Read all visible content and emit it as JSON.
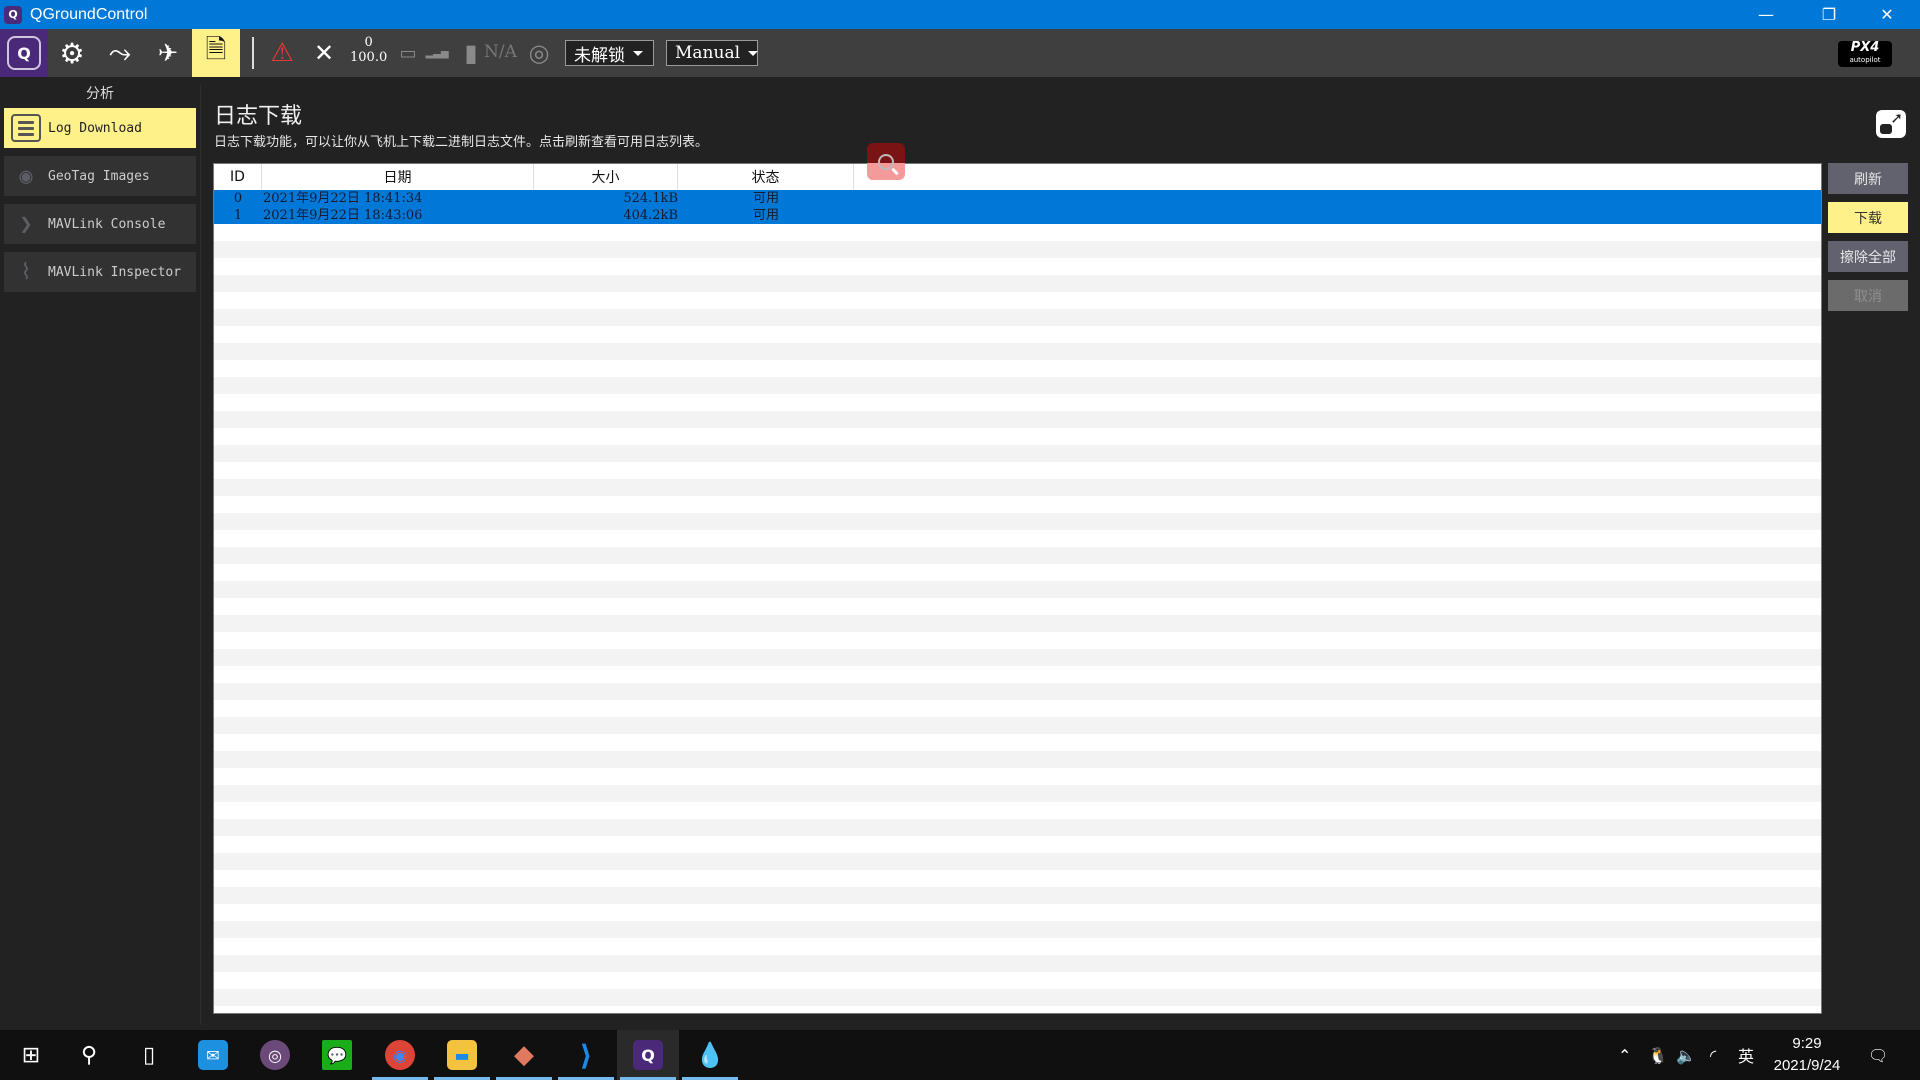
{
  "window": {
    "title": "QGroundControl",
    "controls": {
      "minimize": "—",
      "restore": "❐",
      "close": "✕"
    }
  },
  "toolbar": {
    "items": [
      {
        "name": "qgc-home",
        "icon": "qgc-logo-icon",
        "label": "Q"
      },
      {
        "name": "vehicle-setup",
        "icon": "gears-icon",
        "label": "⚙"
      },
      {
        "name": "plan-flight",
        "icon": "route-icon",
        "label": "⤳"
      },
      {
        "name": "fly",
        "icon": "paper-plane-icon",
        "label": "✈"
      },
      {
        "name": "analyze",
        "icon": "document-search-icon",
        "label": "🗎",
        "active": true
      }
    ],
    "status": {
      "warning_icon": "⚠",
      "gps_icon": "✕",
      "gps_satellites": "0",
      "gps_hdop": "100.0",
      "rc_icon": "▭",
      "signal_icon": "▂▃▅",
      "battery_icon": "▮",
      "battery_value": "N/A",
      "gps_lock_icon": "◎"
    },
    "arm_status": {
      "value": "未解锁"
    },
    "flight_mode": {
      "value": "Manual"
    },
    "brand": {
      "logo": "PX4",
      "sub": "autopilot"
    }
  },
  "sidebar": {
    "heading": "分析",
    "items": [
      {
        "label": "Log Download",
        "icon": "list-icon",
        "active": true
      },
      {
        "label": "GeoTag Images",
        "icon": "map-pin-icon",
        "glyph": "◉",
        "active": false
      },
      {
        "label": "MAVLink Console",
        "icon": "chevron-right-icon",
        "glyph": "❯",
        "active": false
      },
      {
        "label": "MAVLink Inspector",
        "icon": "chart-search-icon",
        "glyph": "⌇",
        "active": false
      }
    ]
  },
  "main": {
    "title": "日志下载",
    "description": "日志下载功能，可以让你从飞机上下载二进制日志文件。点击刷新查看可用日志列表。",
    "table": {
      "columns": [
        "ID",
        "日期",
        "大小",
        "状态"
      ],
      "rows": [
        {
          "id": "0",
          "date": "2021年9月22日  18:41:34",
          "size": "524.1kB",
          "status": "可用",
          "selected": true
        },
        {
          "id": "1",
          "date": "2021年9月22日  18:43:06",
          "size": "404.2kB",
          "status": "可用",
          "selected": true
        }
      ]
    },
    "actions": {
      "refresh": "刷新",
      "download": "下载",
      "erase_all": "擦除全部",
      "cancel": "取消"
    }
  },
  "taskbar": {
    "apps": [
      {
        "name": "start",
        "glyph": "⊞"
      },
      {
        "name": "search",
        "glyph": "⚲"
      },
      {
        "name": "task-view",
        "glyph": "▯"
      },
      {
        "name": "mail",
        "glyph": "✉",
        "color": "#1e90e0"
      },
      {
        "name": "music",
        "glyph": "◎",
        "color": "#6b4a7a"
      },
      {
        "name": "wechat",
        "glyph": "💬",
        "color": "#1aad19"
      },
      {
        "name": "chrome",
        "glyph": "◉",
        "color": "#db4437",
        "running": true
      },
      {
        "name": "file-explorer",
        "glyph": "▬",
        "color": "#f3c23f",
        "running": true
      },
      {
        "name": "git-client",
        "glyph": "◆",
        "color": "#e07a5f",
        "running": true
      },
      {
        "name": "vscode",
        "glyph": "⟩",
        "color": "#1e88e5",
        "running": true
      },
      {
        "name": "qgroundcontrol",
        "glyph": "Q",
        "color": "#4a2a78",
        "running": true,
        "active": true
      },
      {
        "name": "paint-app",
        "glyph": "💧",
        "color": "#d94fa0",
        "running": true
      }
    ],
    "tray": {
      "chevron": "⌃",
      "qq": "🐧",
      "volume": "🔈",
      "wifi": "◜",
      "ime": "英",
      "time": "9:29",
      "date": "2021/9/24",
      "notifications": "🗨"
    }
  }
}
